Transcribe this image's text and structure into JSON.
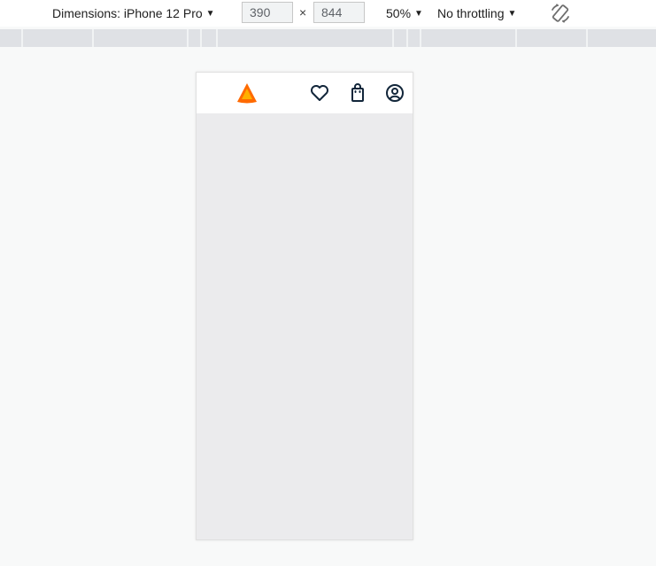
{
  "toolbar": {
    "dimensions_label": "Dimensions: iPhone 12 Pro",
    "width_value": "390",
    "height_value": "844",
    "times_symbol": "×",
    "zoom_label": "50%",
    "throttling_label": "No throttling",
    "caret": "▼",
    "rotate_icon": "rotate-icon"
  },
  "app": {
    "logo_icon": "triangle-logo",
    "header_icons": [
      "heart-icon",
      "shopping-bag-icon",
      "user-account-icon"
    ],
    "brand_color": "#ff6a00",
    "icon_color": "#12263a"
  }
}
